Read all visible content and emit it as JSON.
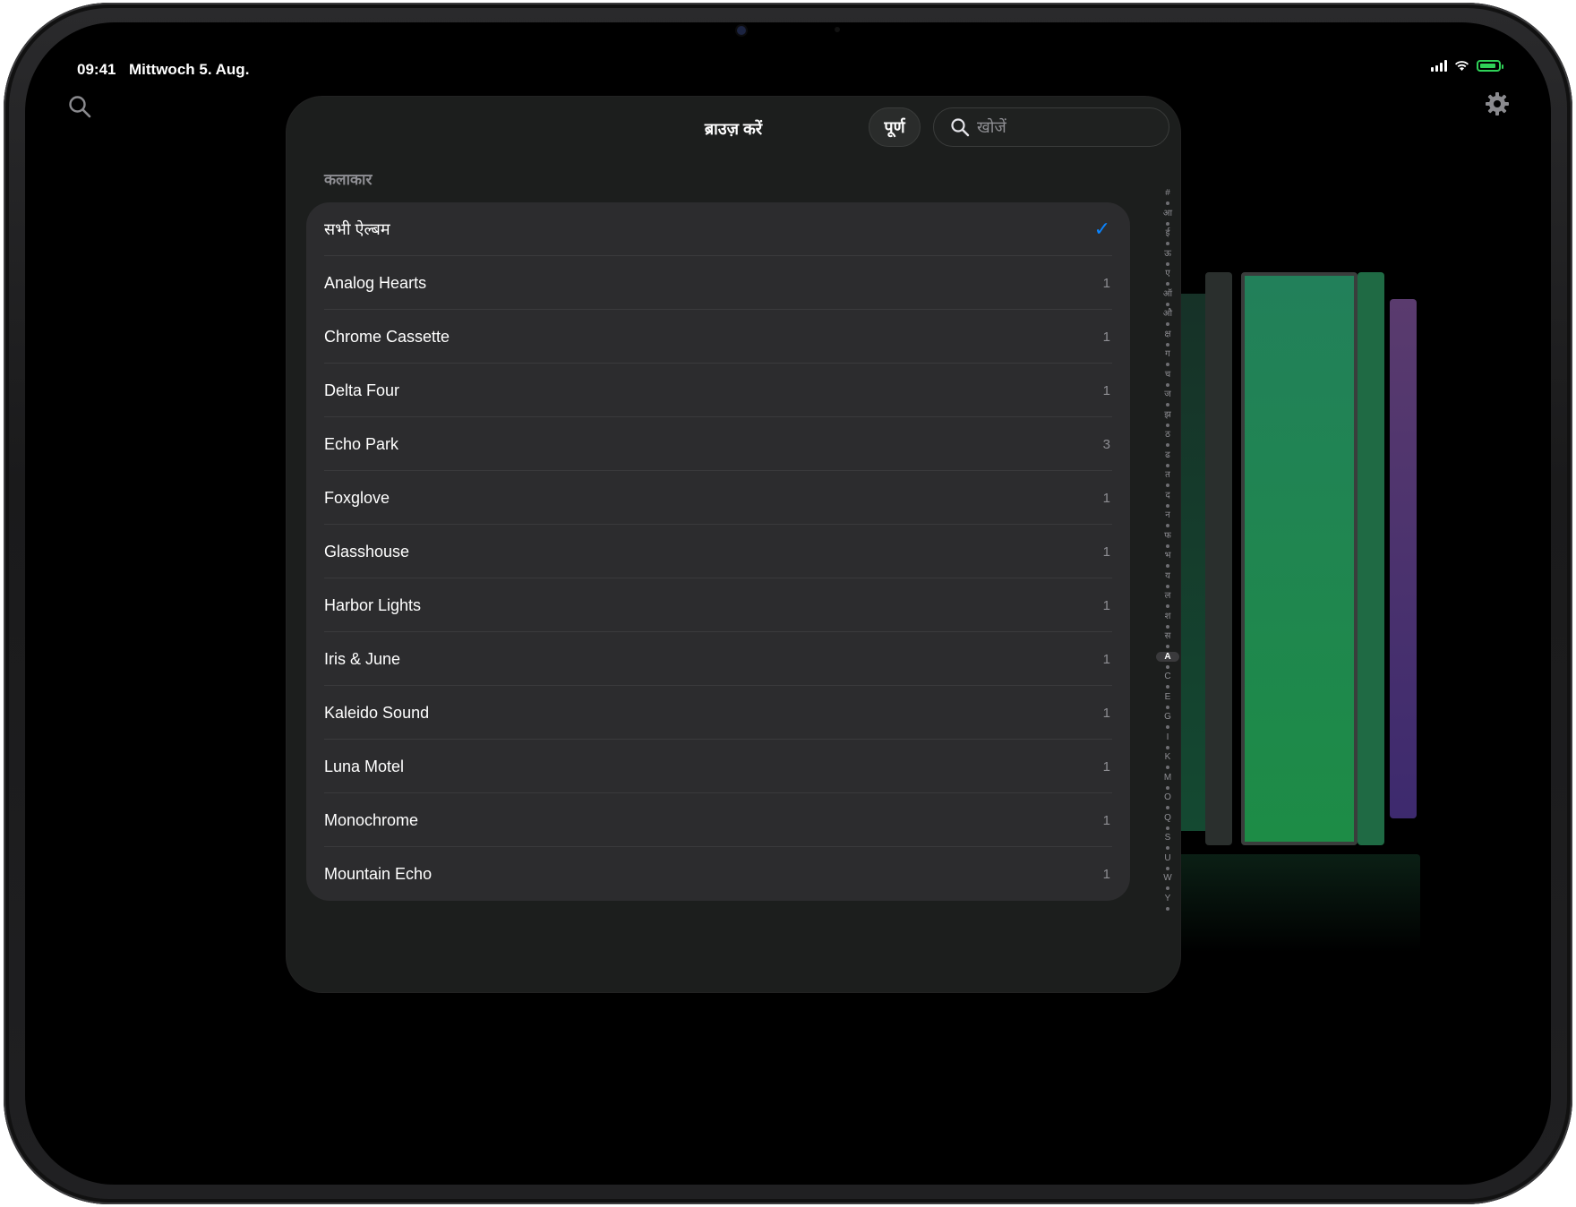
{
  "status_bar": {
    "time": "09:41",
    "date": "Mittwoch 5. Aug."
  },
  "sheet": {
    "title": "ब्राउज़ करें",
    "done_label": "पूर्ण",
    "search_placeholder": "खोजें",
    "section_header": "कलाकार",
    "rows": [
      {
        "name": "सभी ऐल्बम",
        "count": "",
        "checked": true
      },
      {
        "name": "Analog Hearts",
        "count": "1"
      },
      {
        "name": "Chrome Cassette",
        "count": "1"
      },
      {
        "name": "Delta Four",
        "count": "1"
      },
      {
        "name": "Echo Park",
        "count": "3"
      },
      {
        "name": "Foxglove",
        "count": "1"
      },
      {
        "name": "Glasshouse",
        "count": "1"
      },
      {
        "name": "Harbor Lights",
        "count": "1"
      },
      {
        "name": "Iris & June",
        "count": "1"
      },
      {
        "name": "Kaleido Sound",
        "count": "1"
      },
      {
        "name": "Luna Motel",
        "count": "1"
      },
      {
        "name": "Monochrome",
        "count": "1"
      },
      {
        "name": "Mountain Echo",
        "count": "1"
      }
    ],
    "index_letters": [
      "#",
      "आ",
      "ई",
      "ऊ",
      "ए",
      "ऑ",
      "औ",
      "क्ष",
      "ग",
      "च",
      "ज",
      "झ",
      "ठ",
      "ढ",
      "त",
      "द",
      "न",
      "फ",
      "भ",
      "य",
      "ल",
      "श",
      "स",
      "A",
      "C",
      "E",
      "G",
      "I",
      "K",
      "M",
      "O",
      "Q",
      "S",
      "U",
      "W",
      "Y"
    ],
    "index_selected": "A"
  },
  "colors": {
    "accent": "#0a84ff",
    "sheet_bg": "#1c1e1d",
    "list_bg": "#2c2c2e"
  },
  "icons": {
    "search": "magnifier-icon",
    "settings": "gear-icon",
    "checkmark": "checkmark-icon"
  }
}
